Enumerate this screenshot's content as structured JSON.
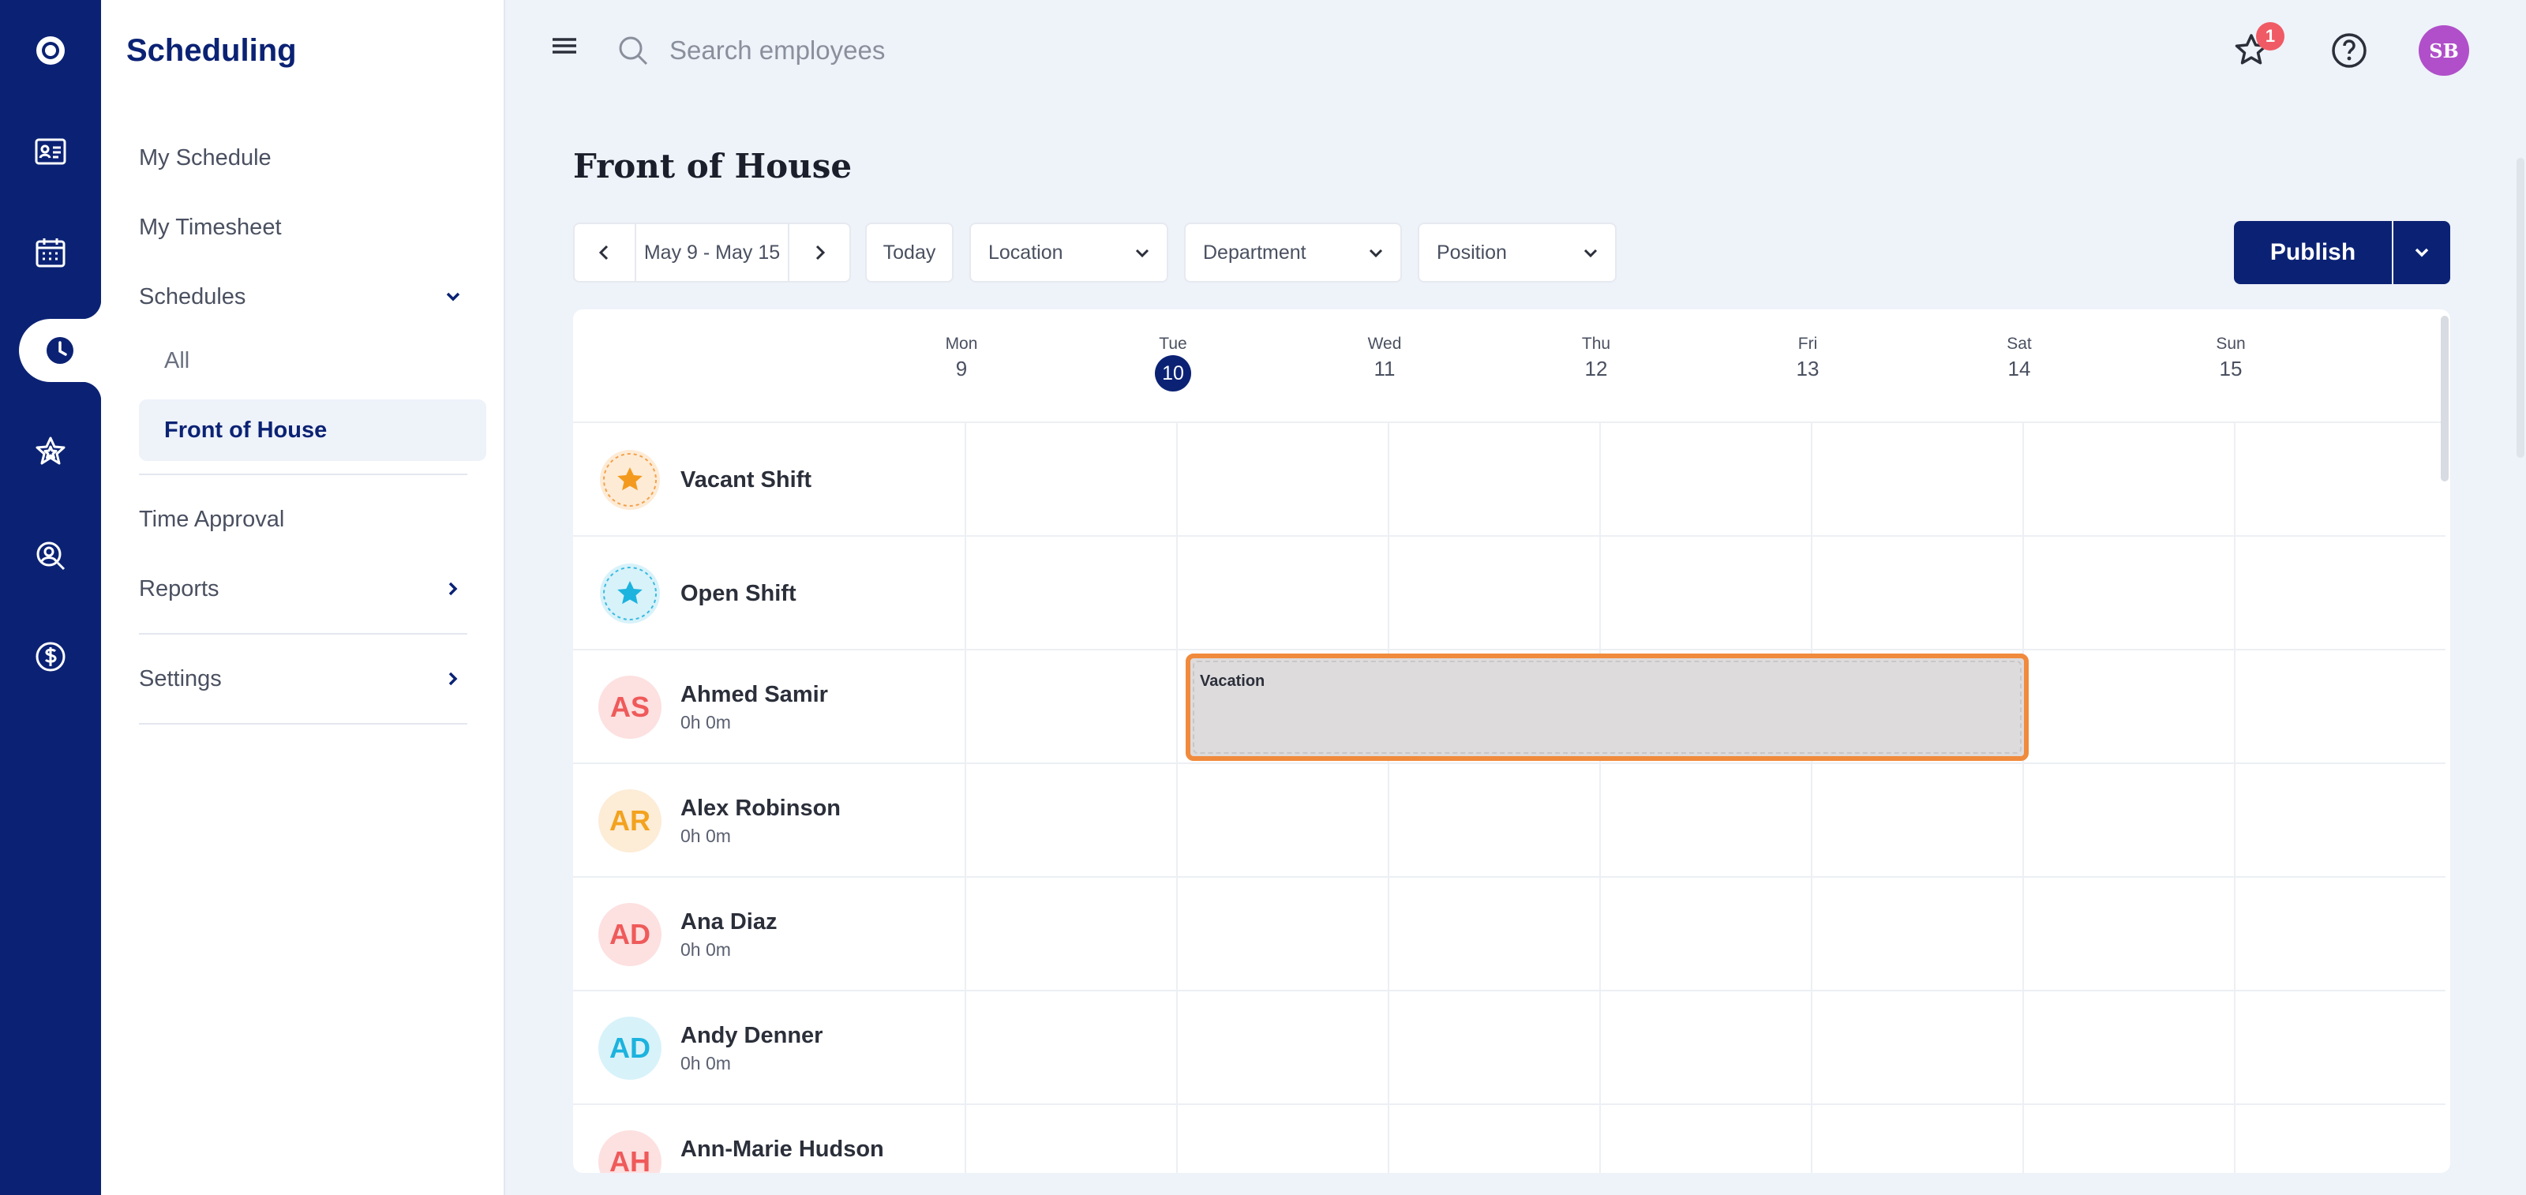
{
  "sidebar": {
    "title": "Scheduling",
    "items": [
      {
        "label": "My Schedule"
      },
      {
        "label": "My Timesheet"
      },
      {
        "label": "Schedules"
      },
      {
        "label": "All"
      },
      {
        "label": "Front of House"
      },
      {
        "label": "Time Approval"
      },
      {
        "label": "Reports"
      },
      {
        "label": "Settings"
      }
    ]
  },
  "topbar": {
    "search_placeholder": "Search employees",
    "notification_count": "1",
    "user_initials": "SB"
  },
  "page": {
    "title": "Front of House",
    "date_range": "May 9 - May 15",
    "today_label": "Today",
    "location_label": "Location",
    "department_label": "Department",
    "position_label": "Position",
    "publish_label": "Publish"
  },
  "days": [
    {
      "dow": "Mon",
      "num": "9"
    },
    {
      "dow": "Tue",
      "num": "10"
    },
    {
      "dow": "Wed",
      "num": "11"
    },
    {
      "dow": "Thu",
      "num": "12"
    },
    {
      "dow": "Fri",
      "num": "13"
    },
    {
      "dow": "Sat",
      "num": "14"
    },
    {
      "dow": "Sun",
      "num": "15"
    }
  ],
  "rows": {
    "vacant": {
      "name": "Vacant Shift"
    },
    "open": {
      "name": "Open Shift"
    },
    "employees": [
      {
        "initials": "AS",
        "name": "Ahmed Samir",
        "hours": "0h 0m"
      },
      {
        "initials": "AR",
        "name": "Alex Robinson",
        "hours": "0h 0m"
      },
      {
        "initials": "AD",
        "name": "Ana Diaz",
        "hours": "0h 0m"
      },
      {
        "initials": "AD",
        "name": "Andy Denner",
        "hours": "0h 0m"
      },
      {
        "initials": "AH",
        "name": "Ann-Marie Hudson",
        "hours": ""
      }
    ]
  },
  "vacation": {
    "label": "Vacation"
  },
  "colors": {
    "brand": "#0b2274",
    "vacation_border": "#f08a3c",
    "badge": "#f05a64",
    "user_avatar": "#b04fc9"
  }
}
